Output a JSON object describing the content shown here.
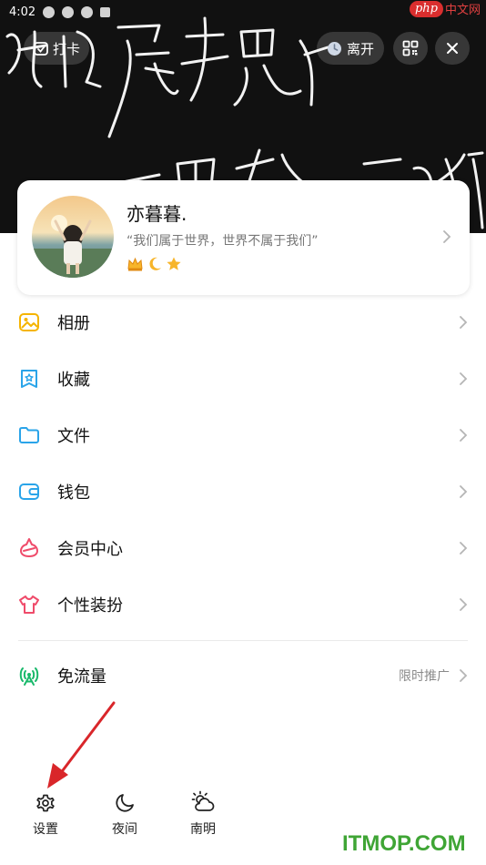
{
  "status_bar": {
    "time": "4:02"
  },
  "watermark": {
    "php_logo": "php",
    "php_site": "中文网",
    "bottom": "ITMOP.COM"
  },
  "header": {
    "checkin_label": "打卡",
    "away_label": "离开",
    "icons": {
      "checkin": "calendar-check-icon",
      "away": "clock-icon",
      "qr": "qr-code-icon",
      "close": "close-icon"
    }
  },
  "profile": {
    "nickname": "亦暮暮.",
    "signature": "“我们属于世界，世界不属于我们”",
    "badges": [
      "crown-icon",
      "moon-icon",
      "star-icon"
    ]
  },
  "menu": {
    "items": [
      {
        "label": "相册",
        "icon": "album-icon",
        "color": "#f5b400"
      },
      {
        "label": "收藏",
        "icon": "favorite-icon",
        "color": "#2aa4e9"
      },
      {
        "label": "文件",
        "icon": "folder-icon",
        "color": "#2aa4e9"
      },
      {
        "label": "钱包",
        "icon": "wallet-icon",
        "color": "#2aa4e9"
      },
      {
        "label": "会员中心",
        "icon": "vip-icon",
        "color": "#ef4b6a"
      },
      {
        "label": "个性装扮",
        "icon": "tshirt-icon",
        "color": "#ef4b6a"
      }
    ],
    "free_traffic": {
      "label": "免流量",
      "extra": "限时推广",
      "icon": "signal-icon",
      "color": "#19b96b"
    }
  },
  "bottom_bar": [
    {
      "label": "设置",
      "icon": "gear-icon"
    },
    {
      "label": "夜间",
      "icon": "moon-icon"
    },
    {
      "label": "南明",
      "icon": "weather-icon"
    }
  ],
  "colors": {
    "annotation_arrow": "#d9262a",
    "header_bg": "#111111"
  }
}
